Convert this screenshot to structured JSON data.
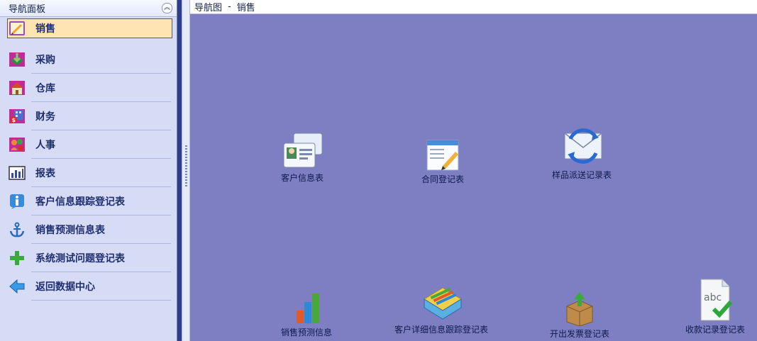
{
  "sidebar": {
    "title": "导航面板",
    "collapse_glyph": "︽",
    "items": [
      {
        "label": "销售",
        "icon": "sales-pencil-icon"
      },
      {
        "label": "采购",
        "icon": "purchase-book-icon"
      },
      {
        "label": "仓库",
        "icon": "warehouse-house-icon"
      },
      {
        "label": "财务",
        "icon": "finance-money-icon"
      },
      {
        "label": "人事",
        "icon": "personnel-people-icon"
      },
      {
        "label": "报表",
        "icon": "report-chart-icon"
      },
      {
        "label": "客户信息跟踪登记表",
        "icon": "info-icon"
      },
      {
        "label": "销售预测信息表",
        "icon": "anchor-icon"
      },
      {
        "label": "系统测试问题登记表",
        "icon": "plus-icon"
      },
      {
        "label": "返回数据中心",
        "icon": "back-arrow-icon"
      }
    ]
  },
  "breadcrumb": {
    "root": "导航图",
    "separator": "-",
    "current": "销售"
  },
  "tiles": [
    {
      "label": "客户信息表",
      "icon": "contact-cards-icon"
    },
    {
      "label": "合同登记表",
      "icon": "contract-edit-icon"
    },
    {
      "label": "样品派送记录表",
      "icon": "mail-sync-icon"
    },
    {
      "label": "销售预测信息",
      "icon": "bar-chart-icon"
    },
    {
      "label": "客户详细信息跟踪登记表",
      "icon": "file-tray-icon"
    },
    {
      "label": "开出发票登记表",
      "icon": "box-upload-icon"
    },
    {
      "label": "收款记录登记表",
      "icon": "abc-check-doc-icon"
    }
  ],
  "colors": {
    "main_bg": "#7e7fc3",
    "sidebar_bg": "#d7dcf6",
    "selected_bg": "#ffe4b3"
  }
}
